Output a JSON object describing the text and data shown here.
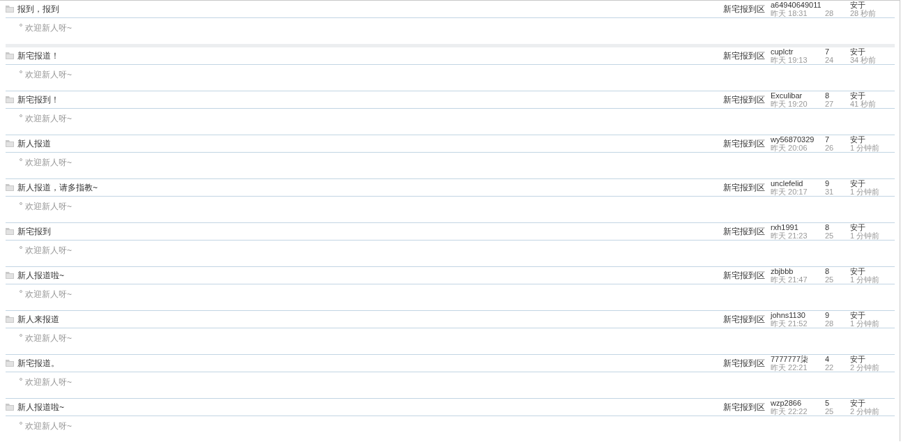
{
  "threads": [
    {
      "title": "报到，报到",
      "forum": "新宅报到区",
      "author": "a64940649011",
      "date": "昨天 18:31",
      "views": "28",
      "last_poster": "安于",
      "last_time": "28 秒前",
      "summary": "欢迎新人呀~"
    },
    {
      "title": "新宅报道！",
      "forum": "新宅报到区",
      "author": "cuplctr",
      "date": "昨天 19:13",
      "replies": "7",
      "views": "24",
      "last_poster": "安于",
      "last_time": "34 秒前",
      "summary": "欢迎新人呀~"
    },
    {
      "title": "新宅报到！",
      "forum": "新宅报到区",
      "author": "Exculibar",
      "date": "昨天 19:20",
      "replies": "8",
      "views": "27",
      "last_poster": "安于",
      "last_time": "41 秒前",
      "summary": "欢迎新人呀~"
    },
    {
      "title": "新人报道",
      "forum": "新宅报到区",
      "author": "wy56870329",
      "date": "昨天 20:06",
      "replies": "7",
      "views": "26",
      "last_poster": "安于",
      "last_time": "1 分钟前",
      "summary": "欢迎新人呀~"
    },
    {
      "title": "新人报道，请多指教~",
      "forum": "新宅报到区",
      "author": "unclefelid",
      "date": "昨天 20:17",
      "replies": "9",
      "views": "31",
      "last_poster": "安于",
      "last_time": "1 分钟前",
      "summary": "欢迎新人呀~"
    },
    {
      "title": "新宅报到",
      "forum": "新宅报到区",
      "author": "rxh1991",
      "date": "昨天 21:23",
      "replies": "8",
      "views": "25",
      "last_poster": "安于",
      "last_time": "1 分钟前",
      "summary": "欢迎新人呀~"
    },
    {
      "title": "新人报道啦~",
      "forum": "新宅报到区",
      "author": "zbjbbb",
      "date": "昨天 21:47",
      "replies": "8",
      "views": "25",
      "last_poster": "安于",
      "last_time": "1 分钟前",
      "summary": "欢迎新人呀~"
    },
    {
      "title": "新人来报道",
      "forum": "新宅报到区",
      "author": "johns1130",
      "date": "昨天 21:52",
      "replies": "9",
      "views": "28",
      "last_poster": "安于",
      "last_time": "1 分钟前",
      "summary": "欢迎新人呀~"
    },
    {
      "title": "新宅报道。",
      "forum": "新宅报到区",
      "author": "7777777柒",
      "date": "昨天 22:21",
      "replies": "4",
      "views": "22",
      "last_poster": "安于",
      "last_time": "2 分钟前",
      "summary": "欢迎新人呀~"
    },
    {
      "title": "新人报道啦~",
      "forum": "新宅报到区",
      "author": "wzp2866",
      "date": "昨天 22:22",
      "replies": "5",
      "views": "25",
      "last_poster": "安于",
      "last_time": "2 分钟前",
      "summary": "欢迎新人呀~"
    }
  ]
}
